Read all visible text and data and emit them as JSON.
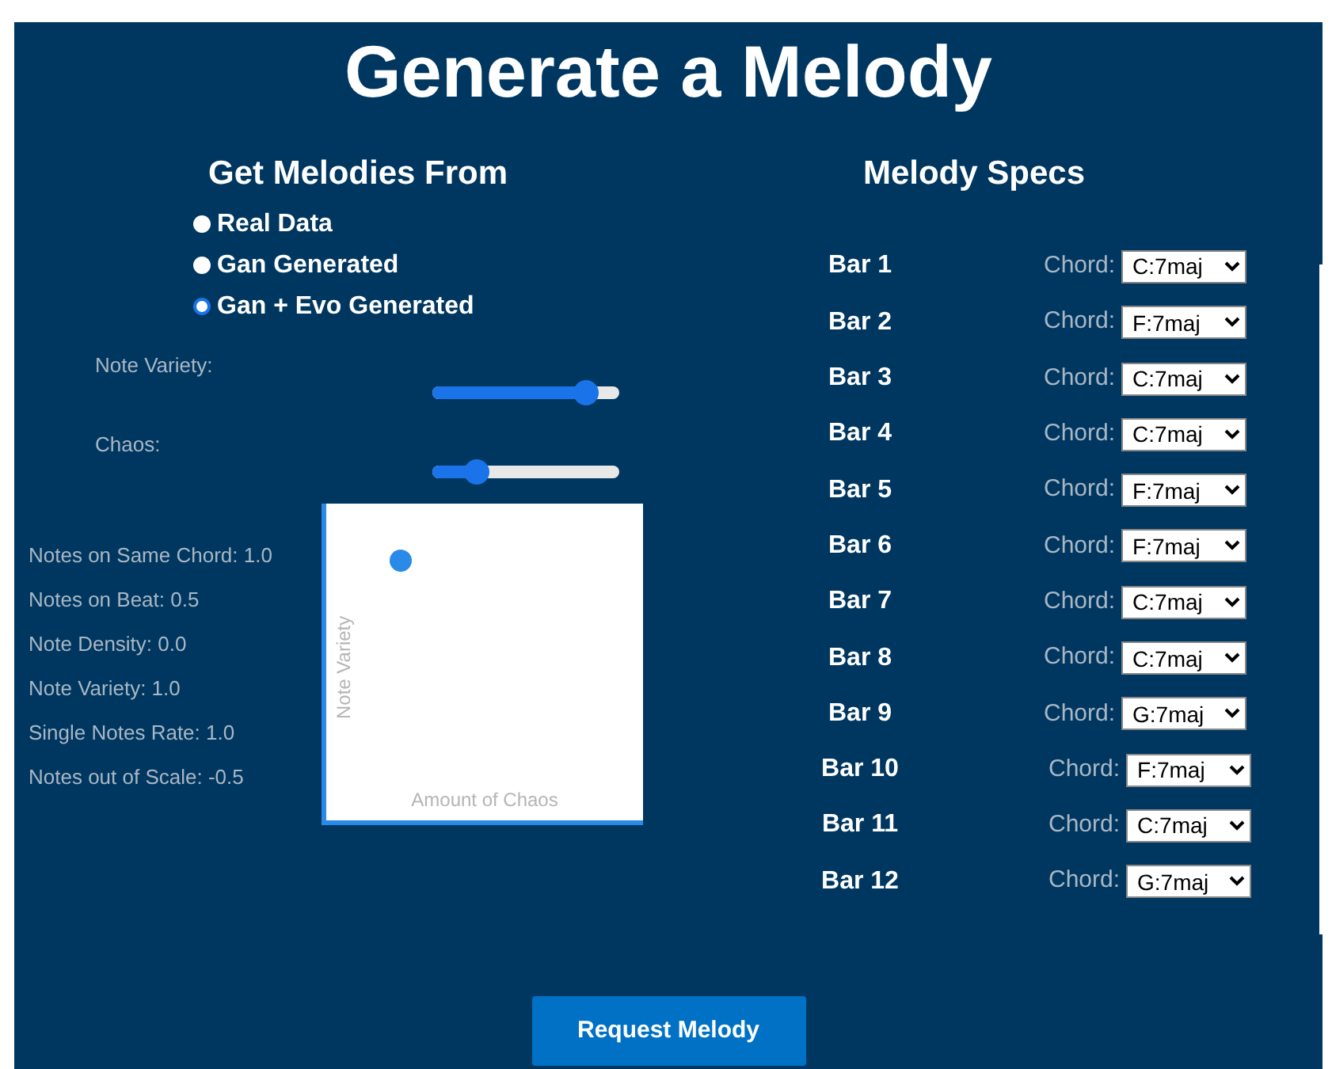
{
  "title": "Generate a Melody",
  "source": {
    "heading": "Get Melodies From",
    "options": [
      {
        "label": "Real Data",
        "selected": false
      },
      {
        "label": "Gan Generated",
        "selected": false
      },
      {
        "label": "Gan + Evo Generated",
        "selected": true
      }
    ]
  },
  "sliders": [
    {
      "label": "Note Variety:",
      "level": 0.82
    },
    {
      "label": "Chaos:",
      "level": 0.24
    }
  ],
  "stats": [
    "Notes on Same Chord: 1.0",
    "Notes on Beat: 0.5",
    "Note Density: 0.0",
    "Note Variety: 1.0",
    "Single Notes Rate: 1.0",
    "Notes out of Scale: -0.5"
  ],
  "plot": {
    "xlabel": "Amount of Chaos",
    "ylabel": "Note Variety"
  },
  "specs": {
    "heading": "Melody Specs",
    "bars": [
      {
        "label": "Bar 1",
        "chord_label": "Chord:",
        "chord": "C:7maj"
      },
      {
        "label": "Bar 2",
        "chord_label": "Chord:",
        "chord": "F:7maj"
      },
      {
        "label": "Bar 3",
        "chord_label": "Chord:",
        "chord": "C:7maj"
      },
      {
        "label": "Bar 4",
        "chord_label": "Chord:",
        "chord": "C:7maj"
      },
      {
        "label": "Bar 5",
        "chord_label": "Chord:",
        "chord": "F:7maj"
      },
      {
        "label": "Bar 6",
        "chord_label": "Chord:",
        "chord": "F:7maj"
      },
      {
        "label": "Bar 7",
        "chord_label": "Chord:",
        "chord": "C:7maj"
      },
      {
        "label": "Bar 8",
        "chord_label": "Chord:",
        "chord": "C:7maj"
      },
      {
        "label": "Bar 9",
        "chord_label": "Chord:",
        "chord": "G:7maj"
      },
      {
        "label": "Bar 10",
        "chord_label": "Chord:",
        "chord": "F:7maj"
      },
      {
        "label": "Bar 11",
        "chord_label": "Chord:",
        "chord": "C:7maj"
      },
      {
        "label": "Bar 12",
        "chord_label": "Chord:",
        "chord": "G:7maj"
      }
    ]
  },
  "button": "Request Melody"
}
